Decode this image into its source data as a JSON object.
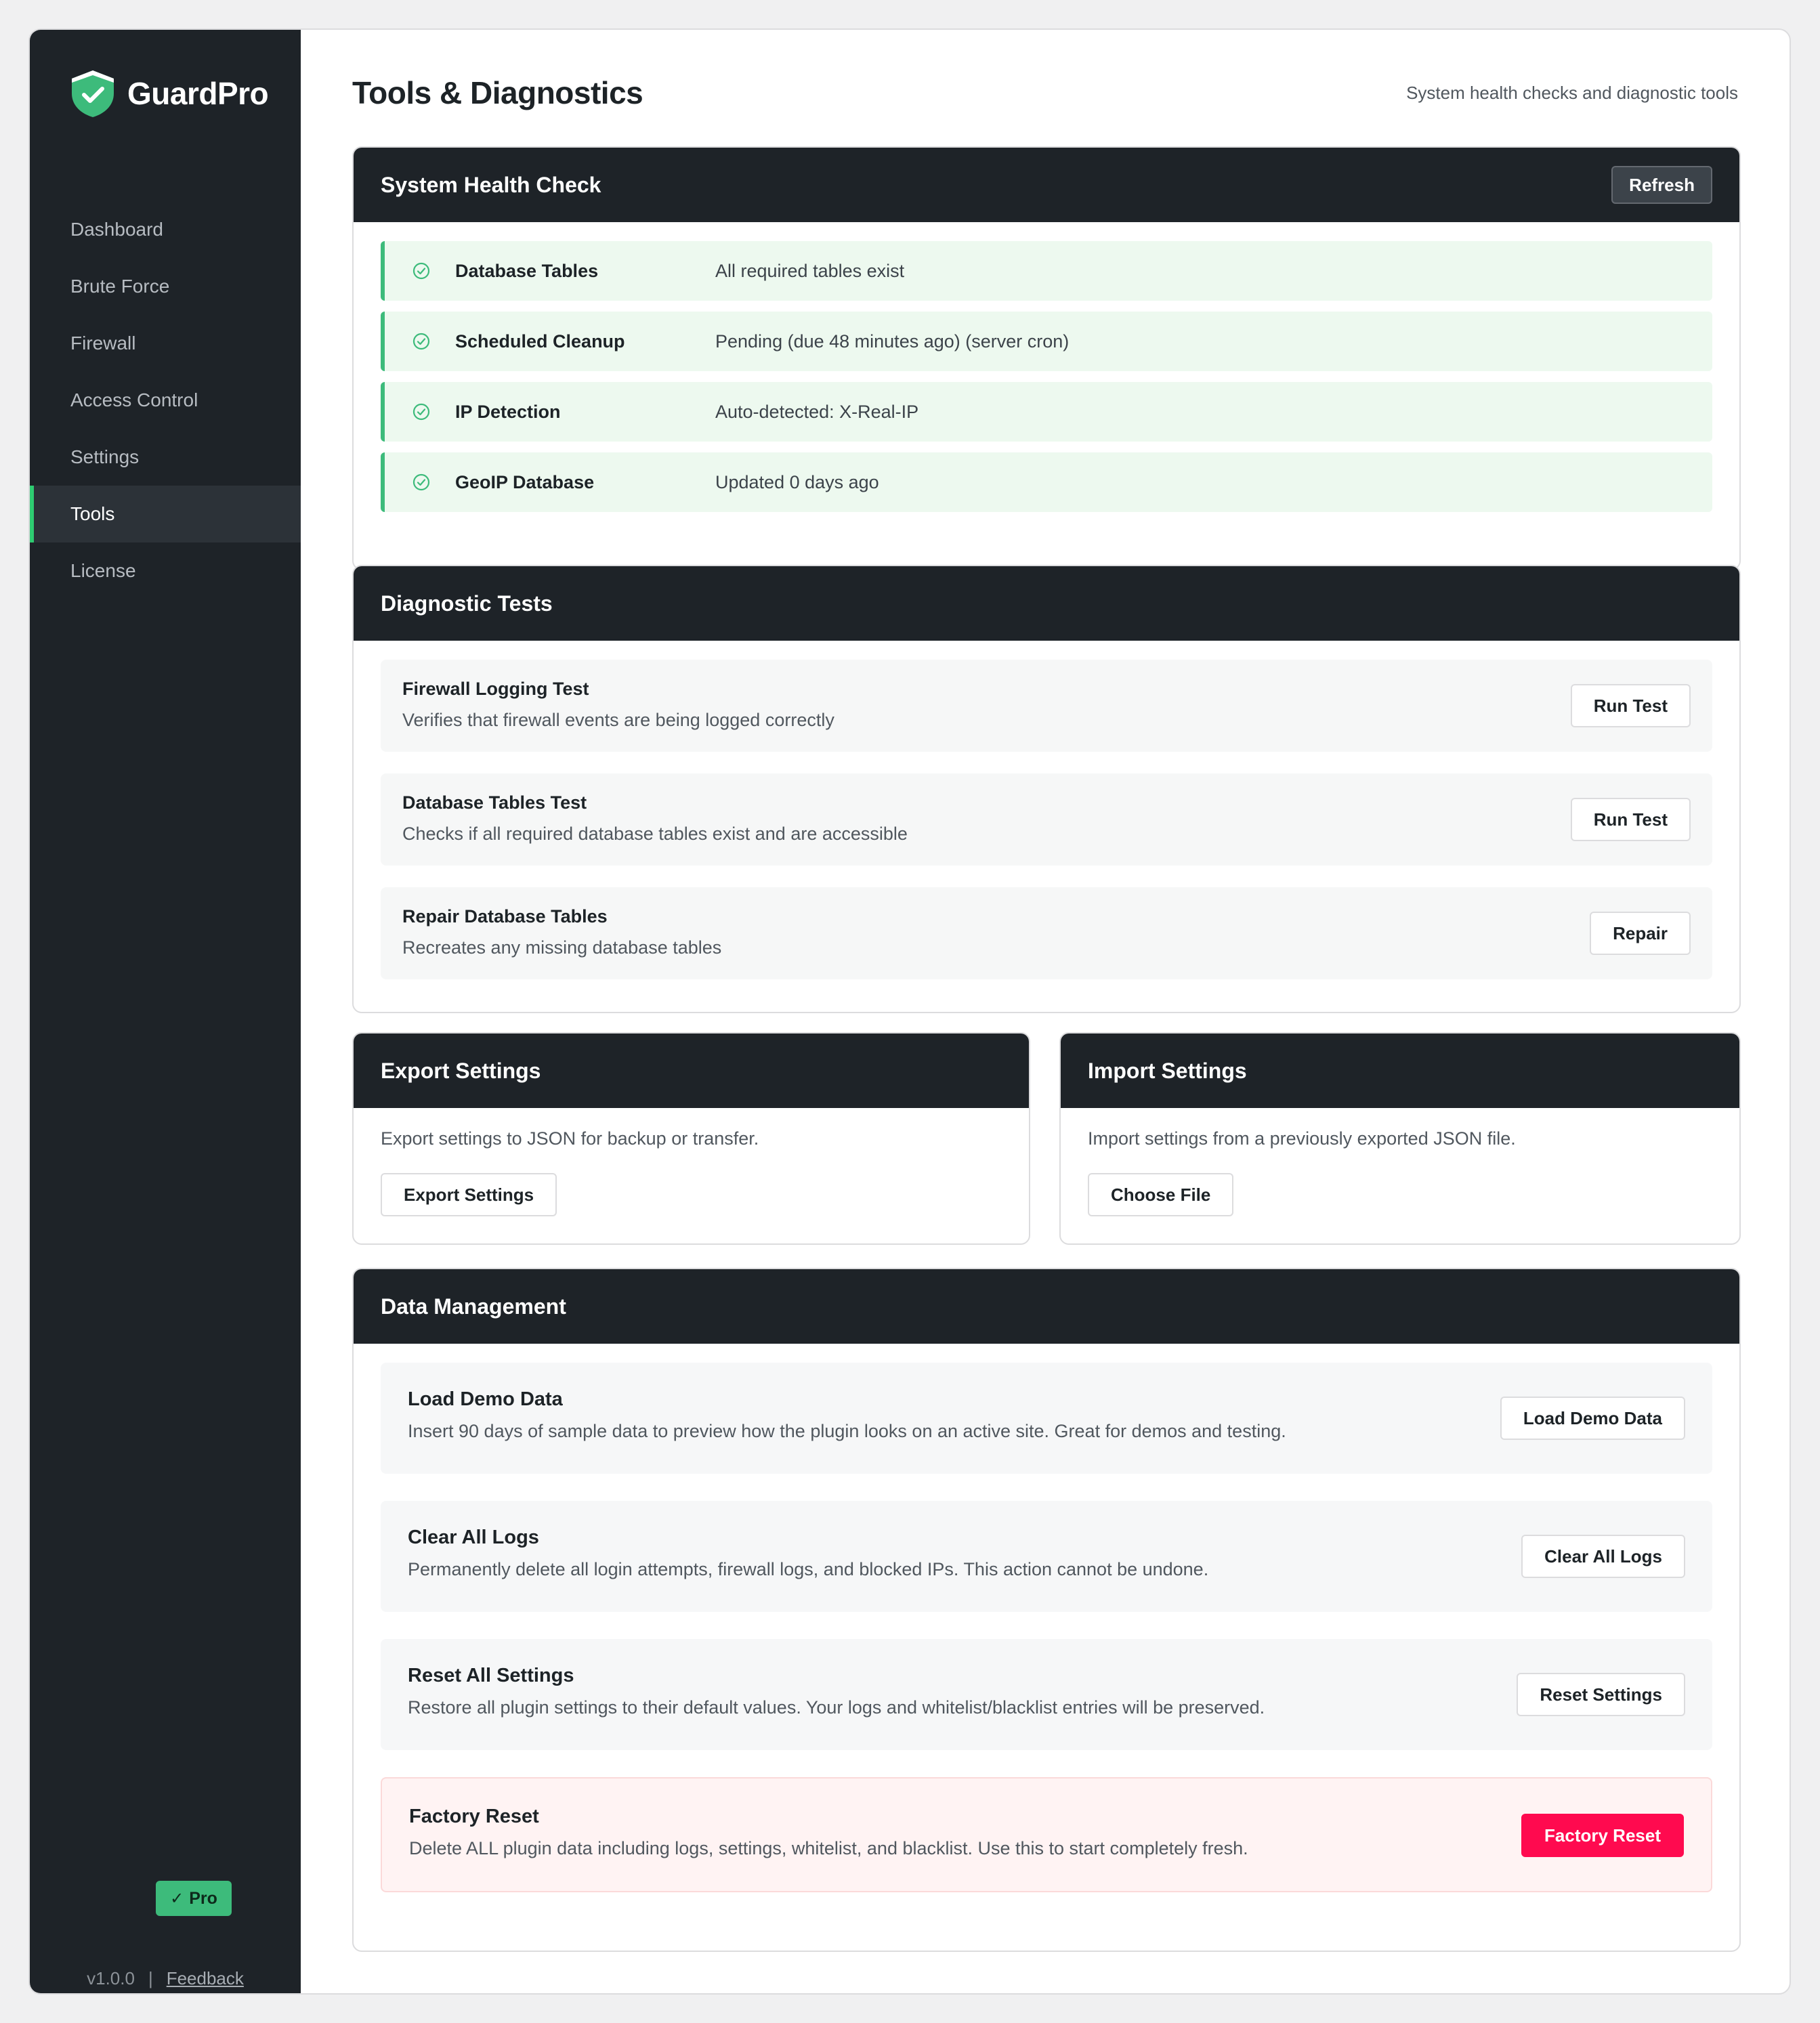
{
  "brand": {
    "name": "GuardPro",
    "accent": "#3dbb7b"
  },
  "sidebar": {
    "items": [
      {
        "label": "Dashboard"
      },
      {
        "label": "Brute Force"
      },
      {
        "label": "Firewall"
      },
      {
        "label": "Access Control"
      },
      {
        "label": "Settings"
      },
      {
        "label": "Tools",
        "active": true
      },
      {
        "label": "License"
      }
    ],
    "badge": "Pro",
    "version": "v1.0.0",
    "separator": "|",
    "feedback": "Feedback"
  },
  "header": {
    "title": "Tools & Diagnostics",
    "subtitle": "System health checks and diagnostic tools"
  },
  "health": {
    "title": "System Health Check",
    "refresh_label": "Refresh",
    "rows": [
      {
        "label": "Database Tables",
        "value": "All required tables exist"
      },
      {
        "label": "Scheduled Cleanup",
        "value": "Pending (due 48 minutes ago) (server cron)"
      },
      {
        "label": "IP Detection",
        "value": "Auto-detected: X-Real-IP"
      },
      {
        "label": "GeoIP Database",
        "value": "Updated 0 days ago"
      }
    ]
  },
  "diagnostics": {
    "title": "Diagnostic Tests",
    "tests": [
      {
        "title": "Firewall Logging Test",
        "desc": "Verifies that firewall events are being logged correctly",
        "button": "Run Test"
      },
      {
        "title": "Database Tables Test",
        "desc": "Checks if all required database tables exist and are accessible",
        "button": "Run Test"
      },
      {
        "title": "Repair Database Tables",
        "desc": "Recreates any missing database tables",
        "button": "Repair"
      }
    ]
  },
  "export": {
    "title": "Export Settings",
    "desc": "Export settings to JSON for backup or transfer.",
    "button": "Export Settings"
  },
  "import": {
    "title": "Import Settings",
    "desc": "Import settings from a previously exported JSON file.",
    "button": "Choose File"
  },
  "data_management": {
    "title": "Data Management",
    "rows": [
      {
        "title": "Load Demo Data",
        "desc": "Insert 90 days of sample data to preview how the plugin looks on an active site. Great for demos and testing.",
        "button": "Load Demo Data"
      },
      {
        "title": "Clear All Logs",
        "desc": "Permanently delete all login attempts, firewall logs, and blocked IPs. This action cannot be undone.",
        "button": "Clear All Logs"
      },
      {
        "title": "Reset All Settings",
        "desc": "Restore all plugin settings to their default values. Your logs and whitelist/blacklist entries will be preserved.",
        "button": "Reset Settings"
      },
      {
        "title": "Factory Reset",
        "desc": "Delete ALL plugin data including logs, settings, whitelist, and blacklist. Use this to start completely fresh.",
        "button": "Factory Reset",
        "danger_color": "#ff0a4f"
      }
    ]
  }
}
